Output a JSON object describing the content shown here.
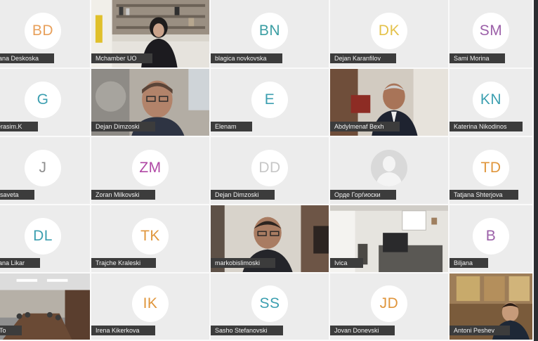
{
  "tiles": [
    {
      "name": "jana Deskoska",
      "initials": "BD",
      "color": "#e8a05b",
      "kind": "avatar"
    },
    {
      "name": "Mchamber UO",
      "kind": "video",
      "scene": "office-woman"
    },
    {
      "name": "blagica novkovska",
      "initials": "BN",
      "color": "#3b9ea3",
      "kind": "avatar"
    },
    {
      "name": "Dejan Karanfilov",
      "initials": "DK",
      "color": "#e4c24a",
      "kind": "avatar"
    },
    {
      "name": "Sami Morina",
      "initials": "SM",
      "color": "#9b5fa8",
      "kind": "avatar"
    },
    {
      "name": "erasim.K",
      "initials": "G",
      "color": "#3c9fb0",
      "kind": "avatar"
    },
    {
      "name": "Dejan Dimzoski",
      "kind": "video",
      "scene": "man-glasses"
    },
    {
      "name": "Elenam",
      "initials": "E",
      "color": "#3c9fb0",
      "kind": "avatar"
    },
    {
      "name": "Abdylmenaf Bexh",
      "kind": "video",
      "scene": "man-suit"
    },
    {
      "name": "Katerina Nikodinos",
      "initials": "KN",
      "color": "#3c9fb0",
      "kind": "avatar"
    },
    {
      "name": "lisaveta",
      "initials": "J",
      "color": "#8f8f8f",
      "kind": "avatar"
    },
    {
      "name": "Zoran Milkovski",
      "initials": "ZM",
      "color": "#b048a5",
      "kind": "avatar"
    },
    {
      "name": "Dejan Dimzoski",
      "initials": "DD",
      "color": "#c7c7c7",
      "kind": "avatar"
    },
    {
      "name": "Орде Горѓиоски",
      "kind": "silhouette"
    },
    {
      "name": "Tatjana Shterjova",
      "initials": "TD",
      "color": "#e0963c",
      "kind": "avatar"
    },
    {
      "name": "jana Likar",
      "initials": "DL",
      "color": "#3c9fb0",
      "kind": "avatar"
    },
    {
      "name": "Trajche Kraleski",
      "initials": "TK",
      "color": "#e0963c",
      "kind": "avatar"
    },
    {
      "name": "markobislimoski",
      "kind": "video",
      "scene": "man-bald"
    },
    {
      "name": "Ivica",
      "kind": "video",
      "scene": "room"
    },
    {
      "name": "Biljana",
      "initials": "B",
      "color": "#9b5fa8",
      "kind": "avatar"
    },
    {
      "name": "-To",
      "kind": "video",
      "scene": "conference"
    },
    {
      "name": "Irena Kikerkova",
      "initials": "IK",
      "color": "#e0963c",
      "kind": "avatar"
    },
    {
      "name": "Sasho Stefanovski",
      "initials": "SS",
      "color": "#3c9fb0",
      "kind": "avatar"
    },
    {
      "name": "Jovan Donevski",
      "initials": "JD",
      "color": "#e0963c",
      "kind": "avatar"
    },
    {
      "name": "Antoni Peshev",
      "kind": "video",
      "scene": "man-dark"
    }
  ]
}
